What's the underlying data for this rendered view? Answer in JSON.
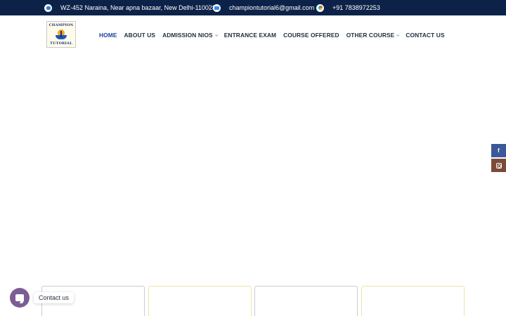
{
  "topbar": {
    "address": "WZ-452 Naraina, Near apna bazaar, New Delhi-110028",
    "email": "championtutorial6@gmail.com",
    "phone": "+91 7838972253",
    "icons": [
      "location-icon",
      "email-icon",
      "phone-icon"
    ]
  },
  "logo": {
    "line1": "CHAMPION",
    "line2": "TUTORIAL"
  },
  "nav": {
    "items": [
      {
        "label": "HOME",
        "active": true,
        "dropdown": false
      },
      {
        "label": "ABOUT US",
        "active": false,
        "dropdown": false
      },
      {
        "label": "ADMISSION NIOS",
        "active": false,
        "dropdown": true
      },
      {
        "label": "ENTRANCE EXAM",
        "active": false,
        "dropdown": false
      },
      {
        "label": "COURSE OFFERED",
        "active": false,
        "dropdown": false
      },
      {
        "label": "OTHER COURSE",
        "active": false,
        "dropdown": true
      },
      {
        "label": "CONTACT US",
        "active": false,
        "dropdown": false
      }
    ]
  },
  "social": {
    "facebook": "f",
    "instagram_icon": "instagram-icon"
  },
  "contact_widget": {
    "label": "Contact us"
  },
  "colors": {
    "topbar_bg": "#0d2248",
    "nav_active": "#16429b",
    "facebook": "#3b5998",
    "instagram": "#7b4a39",
    "chat": "#7c5d95"
  }
}
